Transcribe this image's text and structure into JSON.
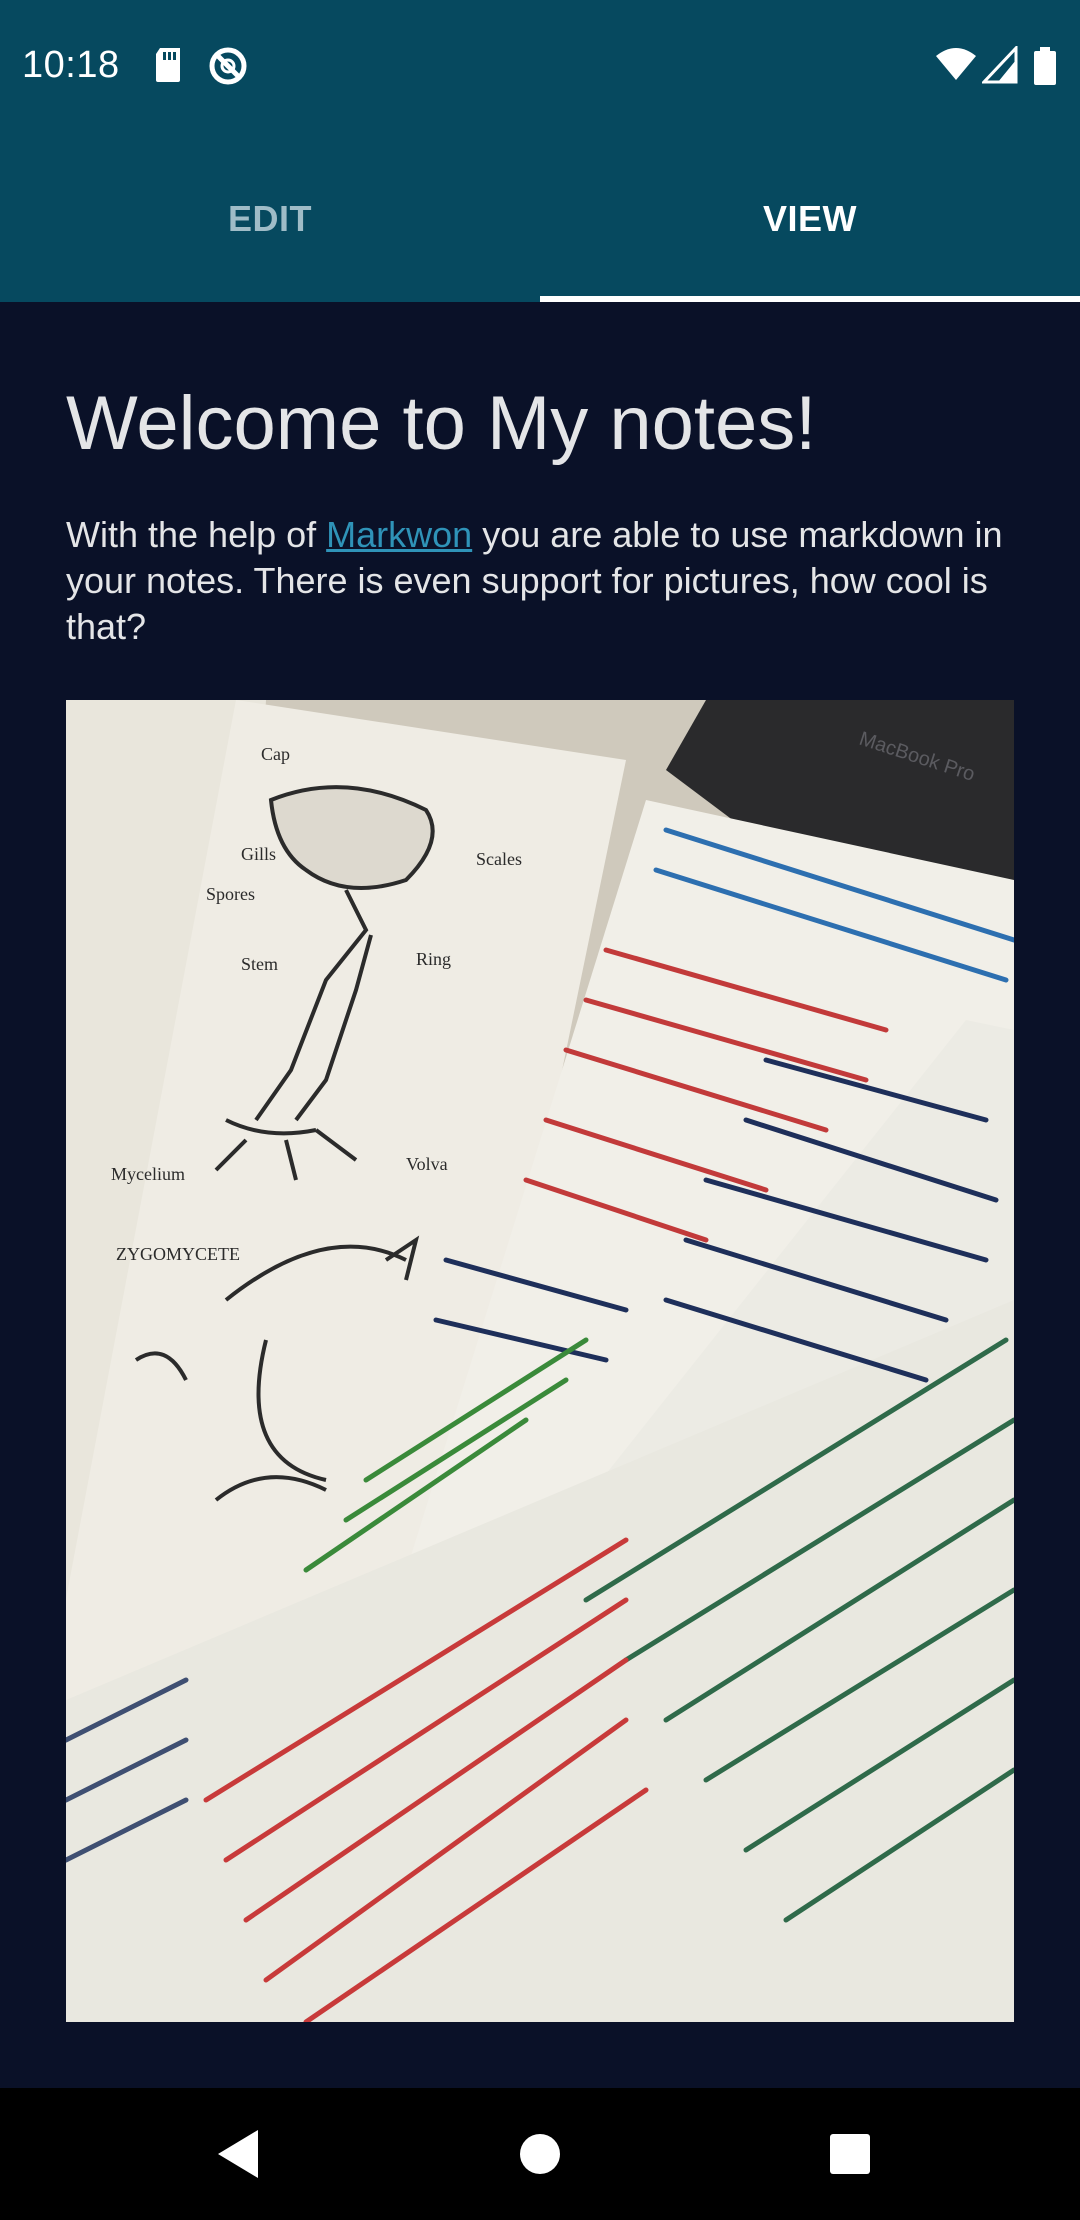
{
  "status_bar": {
    "time": "10:18",
    "left_icons": [
      "sd-card-icon",
      "vpn-icon"
    ],
    "right_icons": [
      "wifi-icon",
      "cellular-signal-icon",
      "battery-icon"
    ]
  },
  "tabs": [
    {
      "label": "EDIT",
      "selected": false
    },
    {
      "label": "VIEW",
      "selected": true
    }
  ],
  "note": {
    "heading": "Welcome to My notes!",
    "paragraph_before_link": "With the help of ",
    "link_text": "Markwon",
    "paragraph_after_link": " you are able to use markdown in your notes. There is even support for pictures, how cool is that?"
  },
  "image": {
    "laptop_text": "MacBook Pro",
    "sketch_labels": [
      "Cap",
      "Gills",
      "Scales",
      "Spores",
      "Stem",
      "Ring",
      "Mycelium",
      "Volva",
      "ZYGOMYCETE"
    ]
  },
  "nav_bar": {
    "buttons": [
      "back-icon",
      "home-icon",
      "recents-icon"
    ]
  },
  "colors": {
    "app_bar": "#06495f",
    "background": "#0a1128",
    "link": "#2f93b8",
    "text": "#e4e5e7"
  }
}
